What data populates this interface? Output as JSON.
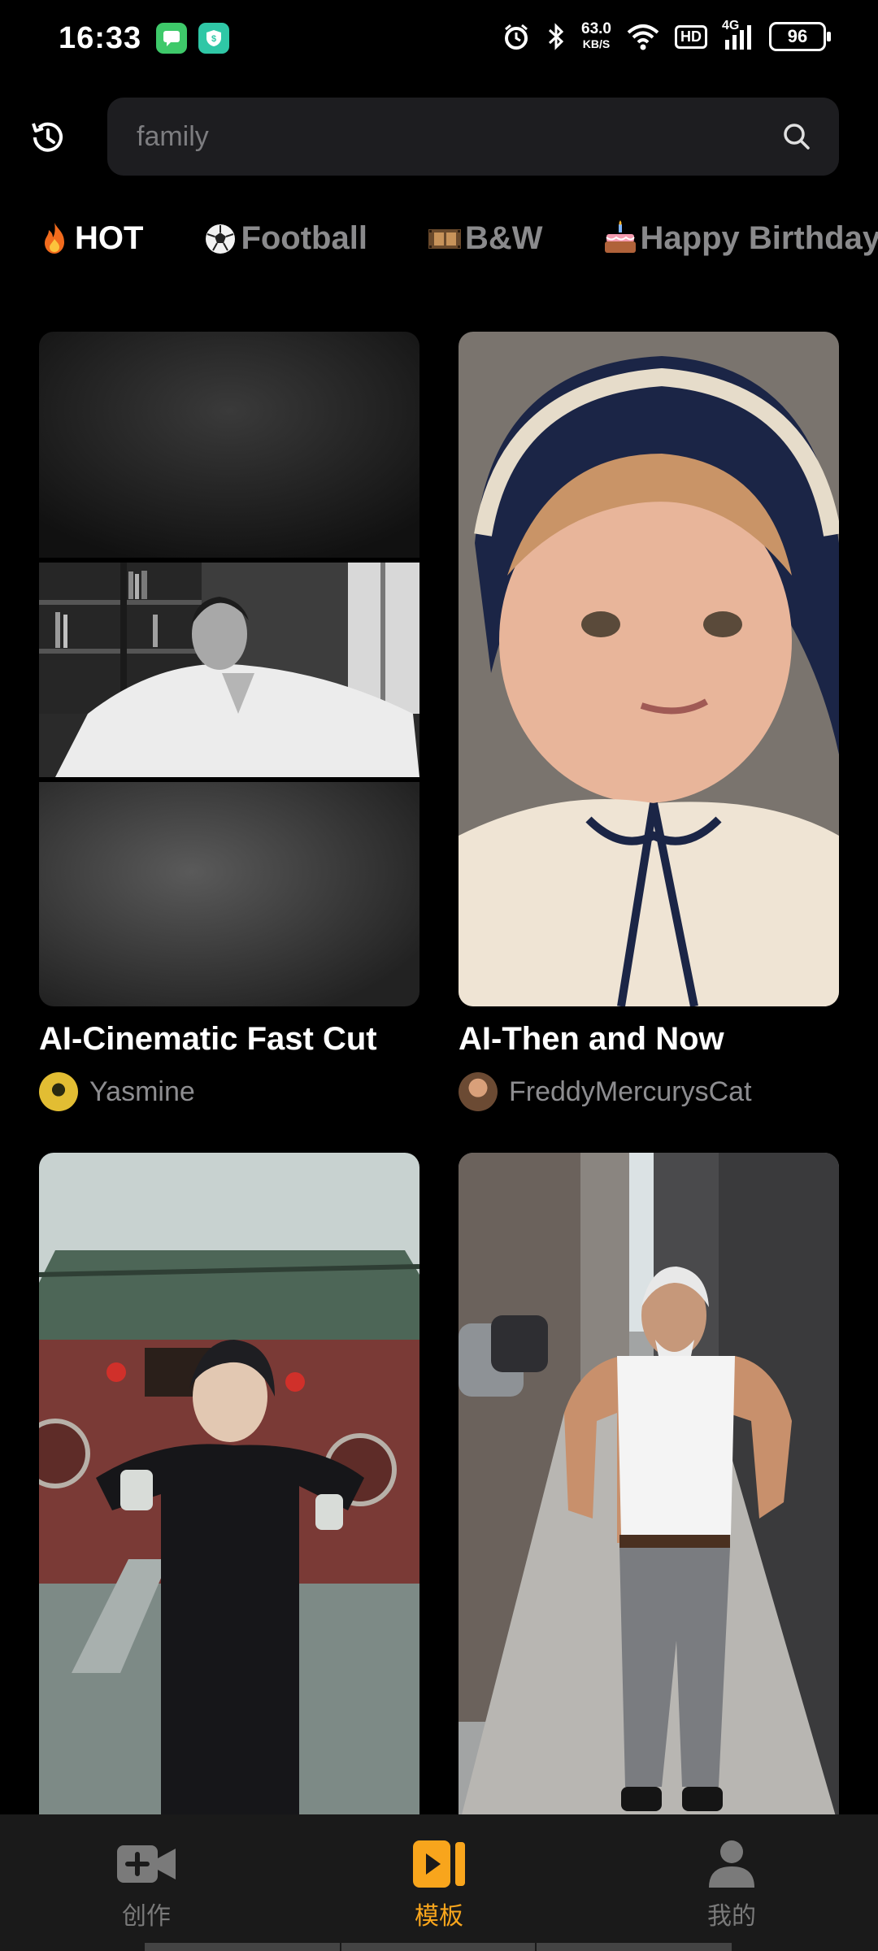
{
  "status_bar": {
    "time": "16:33",
    "net_speed_value": "63.0",
    "net_speed_unit": "KB/S",
    "hd_label": "HD",
    "network_label": "4G",
    "battery": "96"
  },
  "search": {
    "placeholder": "family"
  },
  "tabs": [
    {
      "label": "HOT",
      "icon": "fire-icon",
      "active": true
    },
    {
      "label": "Football",
      "icon": "soccer-ball-icon"
    },
    {
      "label": "B&W",
      "icon": "film-icon"
    },
    {
      "label": "Happy Birthday",
      "icon": "birthday-cake-icon"
    }
  ],
  "cards": [
    {
      "title": "AI-Cinematic Fast Cut",
      "author": "Yasmine"
    },
    {
      "title": "AI-Then and Now",
      "author": "FreddyMercurysCat"
    },
    {
      "title": "",
      "author": ""
    },
    {
      "title": "",
      "author": ""
    }
  ],
  "nav": {
    "create_label": "创作",
    "templates_label": "模板",
    "mine_label": "我的",
    "active_color": "#f8a51c",
    "inactive_color": "#7a7a7a"
  }
}
